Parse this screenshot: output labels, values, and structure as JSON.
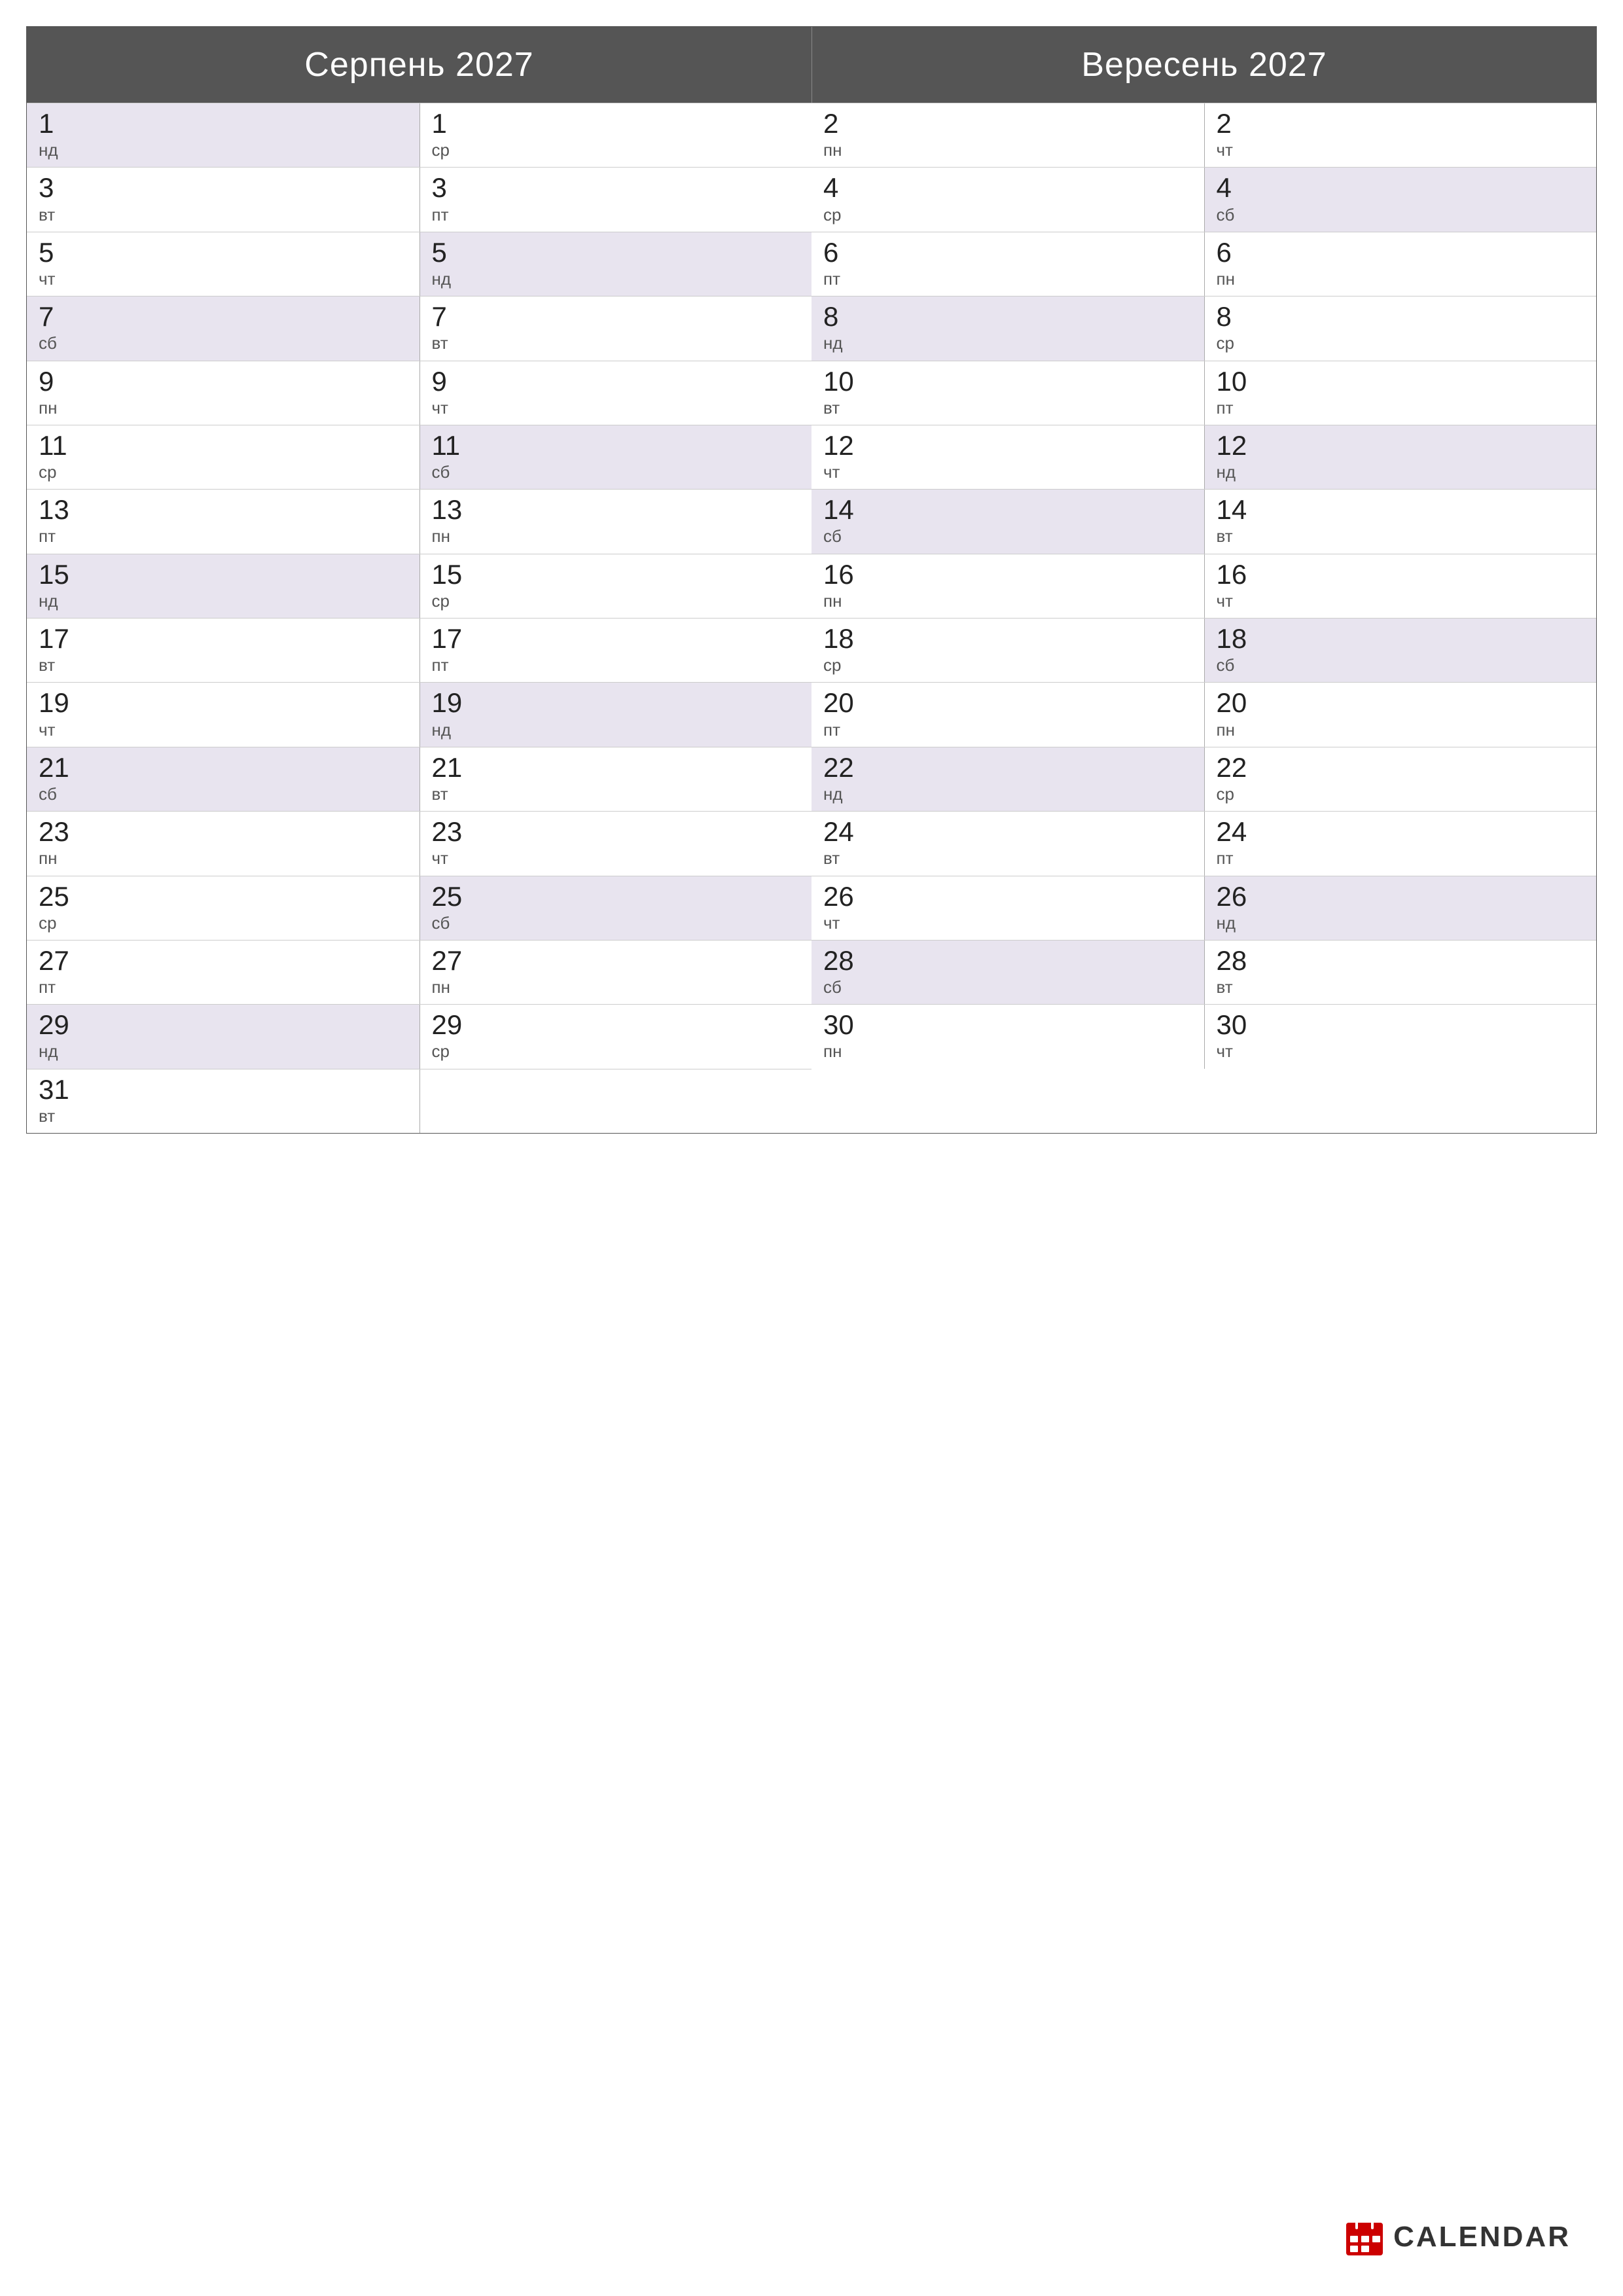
{
  "months": [
    {
      "name": "Серпень 2027",
      "days": [
        {
          "num": "1",
          "day": "нд",
          "weekend": true
        },
        {
          "num": "2",
          "day": "пн",
          "weekend": false
        },
        {
          "num": "3",
          "day": "вт",
          "weekend": false
        },
        {
          "num": "4",
          "day": "ср",
          "weekend": false
        },
        {
          "num": "5",
          "day": "чт",
          "weekend": false
        },
        {
          "num": "6",
          "day": "пт",
          "weekend": false
        },
        {
          "num": "7",
          "day": "сб",
          "weekend": true
        },
        {
          "num": "8",
          "day": "нд",
          "weekend": true
        },
        {
          "num": "9",
          "day": "пн",
          "weekend": false
        },
        {
          "num": "10",
          "day": "вт",
          "weekend": false
        },
        {
          "num": "11",
          "day": "ср",
          "weekend": false
        },
        {
          "num": "12",
          "day": "чт",
          "weekend": false
        },
        {
          "num": "13",
          "day": "пт",
          "weekend": false
        },
        {
          "num": "14",
          "day": "сб",
          "weekend": true
        },
        {
          "num": "15",
          "day": "нд",
          "weekend": true
        },
        {
          "num": "16",
          "day": "пн",
          "weekend": false
        },
        {
          "num": "17",
          "day": "вт",
          "weekend": false
        },
        {
          "num": "18",
          "day": "ср",
          "weekend": false
        },
        {
          "num": "19",
          "day": "чт",
          "weekend": false
        },
        {
          "num": "20",
          "day": "пт",
          "weekend": false
        },
        {
          "num": "21",
          "day": "сб",
          "weekend": true
        },
        {
          "num": "22",
          "day": "нд",
          "weekend": true
        },
        {
          "num": "23",
          "day": "пн",
          "weekend": false
        },
        {
          "num": "24",
          "day": "вт",
          "weekend": false
        },
        {
          "num": "25",
          "day": "ср",
          "weekend": false
        },
        {
          "num": "26",
          "day": "чт",
          "weekend": false
        },
        {
          "num": "27",
          "day": "пт",
          "weekend": false
        },
        {
          "num": "28",
          "day": "сб",
          "weekend": true
        },
        {
          "num": "29",
          "day": "нд",
          "weekend": true
        },
        {
          "num": "30",
          "day": "пн",
          "weekend": false
        },
        {
          "num": "31",
          "day": "вт",
          "weekend": false
        }
      ]
    },
    {
      "name": "Вересень 2027",
      "days": [
        {
          "num": "1",
          "day": "ср",
          "weekend": false
        },
        {
          "num": "2",
          "day": "чт",
          "weekend": false
        },
        {
          "num": "3",
          "day": "пт",
          "weekend": false
        },
        {
          "num": "4",
          "day": "сб",
          "weekend": true
        },
        {
          "num": "5",
          "day": "нд",
          "weekend": true
        },
        {
          "num": "6",
          "day": "пн",
          "weekend": false
        },
        {
          "num": "7",
          "day": "вт",
          "weekend": false
        },
        {
          "num": "8",
          "day": "ср",
          "weekend": false
        },
        {
          "num": "9",
          "day": "чт",
          "weekend": false
        },
        {
          "num": "10",
          "day": "пт",
          "weekend": false
        },
        {
          "num": "11",
          "day": "сб",
          "weekend": true
        },
        {
          "num": "12",
          "day": "нд",
          "weekend": true
        },
        {
          "num": "13",
          "day": "пн",
          "weekend": false
        },
        {
          "num": "14",
          "day": "вт",
          "weekend": false
        },
        {
          "num": "15",
          "day": "ср",
          "weekend": false
        },
        {
          "num": "16",
          "day": "чт",
          "weekend": false
        },
        {
          "num": "17",
          "day": "пт",
          "weekend": false
        },
        {
          "num": "18",
          "day": "сб",
          "weekend": true
        },
        {
          "num": "19",
          "day": "нд",
          "weekend": true
        },
        {
          "num": "20",
          "day": "пн",
          "weekend": false
        },
        {
          "num": "21",
          "day": "вт",
          "weekend": false
        },
        {
          "num": "22",
          "day": "ср",
          "weekend": false
        },
        {
          "num": "23",
          "day": "чт",
          "weekend": false
        },
        {
          "num": "24",
          "day": "пт",
          "weekend": false
        },
        {
          "num": "25",
          "day": "сб",
          "weekend": true
        },
        {
          "num": "26",
          "day": "нд",
          "weekend": true
        },
        {
          "num": "27",
          "day": "пн",
          "weekend": false
        },
        {
          "num": "28",
          "day": "вт",
          "weekend": false
        },
        {
          "num": "29",
          "day": "ср",
          "weekend": false
        },
        {
          "num": "30",
          "day": "чт",
          "weekend": false
        }
      ]
    }
  ],
  "logo": {
    "text": "CALENDAR",
    "icon_color": "#cc0000"
  }
}
